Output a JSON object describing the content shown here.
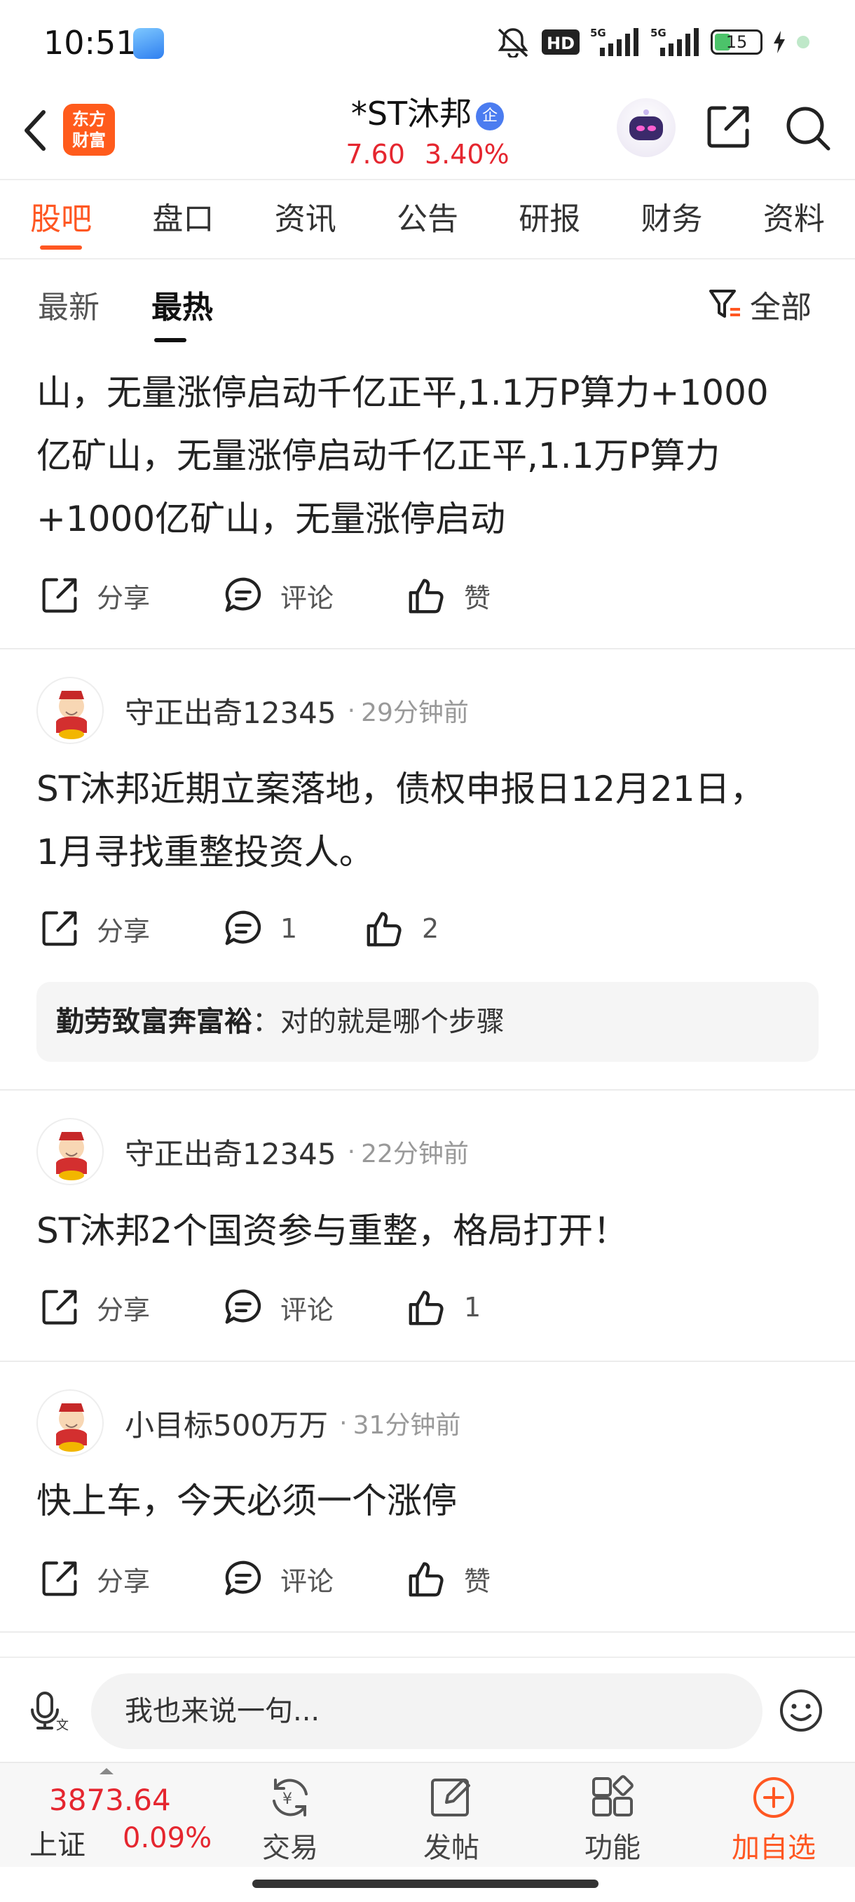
{
  "status": {
    "time": "10:51",
    "battery": "15"
  },
  "header": {
    "logo_line1": "东方",
    "logo_line2": "财富",
    "stock_name": "*ST沐邦",
    "badge": "企",
    "price": "7.60",
    "change_pct": "3.40%"
  },
  "tabs": [
    "股吧",
    "盘口",
    "资讯",
    "公告",
    "研报",
    "财务",
    "资料"
  ],
  "subtabs": {
    "latest": "最新",
    "hot": "最热",
    "filter": "全部"
  },
  "posts": [
    {
      "lines": [
        "山，无量涨停启动千亿正平,1.1万P算力+1000",
        "亿矿山，无量涨停启动千亿正平,1.1万P算力",
        "+1000亿矿山，无量涨停启动"
      ],
      "share": "分享",
      "comment": "评论",
      "like": "赞"
    },
    {
      "user": "守正出奇12345",
      "time": "29分钟前",
      "lines": [
        "ST沐邦近期立案落地，债权申报日12月21日，",
        "1月寻找重整投资人。"
      ],
      "share": "分享",
      "comment": "1",
      "like": "2",
      "reply": {
        "user": "勤劳致富奔富裕",
        "text": "：对的就是哪个步骤"
      }
    },
    {
      "user": "守正出奇12345",
      "time": "22分钟前",
      "lines": [
        "ST沐邦2个国资参与重整，格局打开！"
      ],
      "share": "分享",
      "comment": "评论",
      "like": "1"
    },
    {
      "user": "小目标500万万",
      "time": "31分钟前",
      "lines": [
        "快上车，今天必须一个涨停"
      ],
      "share": "分享",
      "comment": "评论",
      "like": "赞"
    }
  ],
  "comment_bar": {
    "placeholder": "我也来说一句..."
  },
  "bottom_nav": {
    "index_value": "3873.64",
    "index_name": "上证",
    "index_pct": "0.09%",
    "trade": "交易",
    "post": "发帖",
    "functions": "功能",
    "add_watch": "加自选"
  },
  "colors": {
    "accent": "#ff5722",
    "rise": "#e5262f"
  }
}
